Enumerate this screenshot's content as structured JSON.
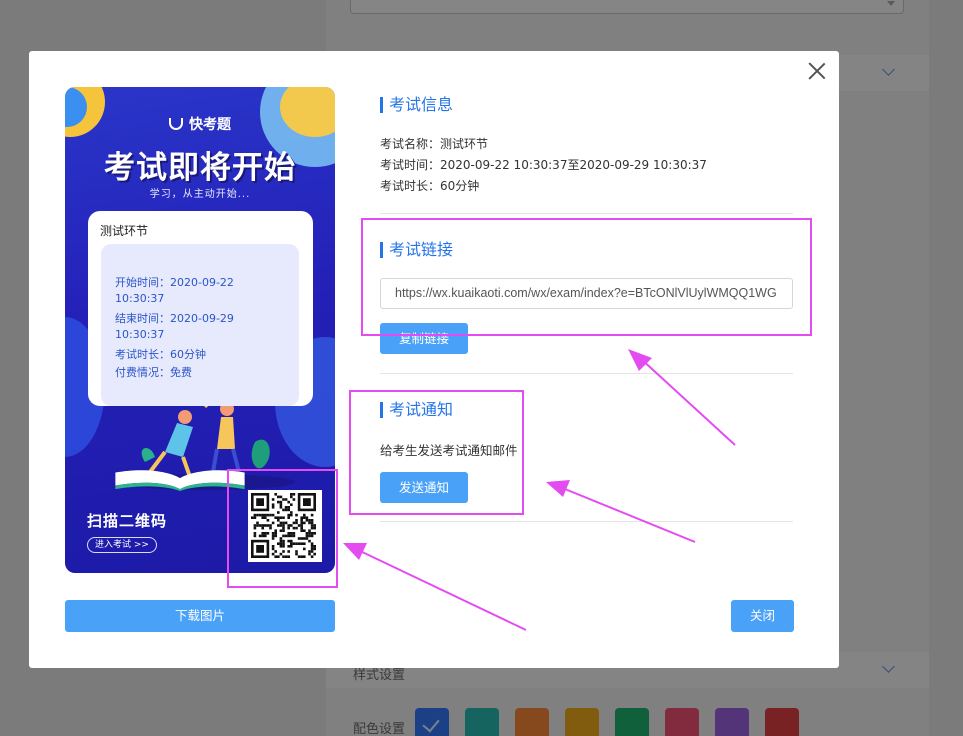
{
  "background": {
    "style_section_label": "样式设置",
    "color_setting_label": "配色设置",
    "color_swatches": [
      "#2f6ae0",
      "#24a6a0",
      "#df7a30",
      "#d99a18",
      "#1aa062",
      "#d94868",
      "#8a56c8",
      "#c8383c"
    ]
  },
  "poster": {
    "brand": "快考题",
    "headline": "考试即将开始",
    "tagline": "学习，从主动开始...",
    "card_title": "测试环节",
    "start_label": "开始时间：",
    "start_value": "2020-09-22",
    "start_time": "10:30:37",
    "end_label": "结束时间：",
    "end_value": "2020-09-29",
    "end_time": "10:30:37",
    "duration_line": "考试时长：60分钟",
    "payment_line": "付费情况：免费",
    "scan_text": "扫描二维码",
    "enter_exam": "进入考试 >>"
  },
  "exam_info": {
    "title": "考试信息",
    "name_line": "考试名称：测试环节",
    "time_line": "考试时间：2020-09-22 10:30:37至2020-09-29 10:30:37",
    "duration_line": "考试时长：60分钟"
  },
  "exam_link": {
    "title": "考试链接",
    "url": "https://wx.kuaikaoti.com/wx/exam/index?e=BTcONlVlUylWMQQ1WG",
    "copy_button": "复制链接"
  },
  "exam_notice": {
    "title": "考试通知",
    "description": "给考生发送考试通知邮件",
    "send_button": "发送通知"
  },
  "footer": {
    "download_button": "下载图片",
    "close_button": "关闭"
  },
  "colors": {
    "accent": "#2475e8",
    "button": "#4aa2f8",
    "highlight": "#e34cf0"
  }
}
